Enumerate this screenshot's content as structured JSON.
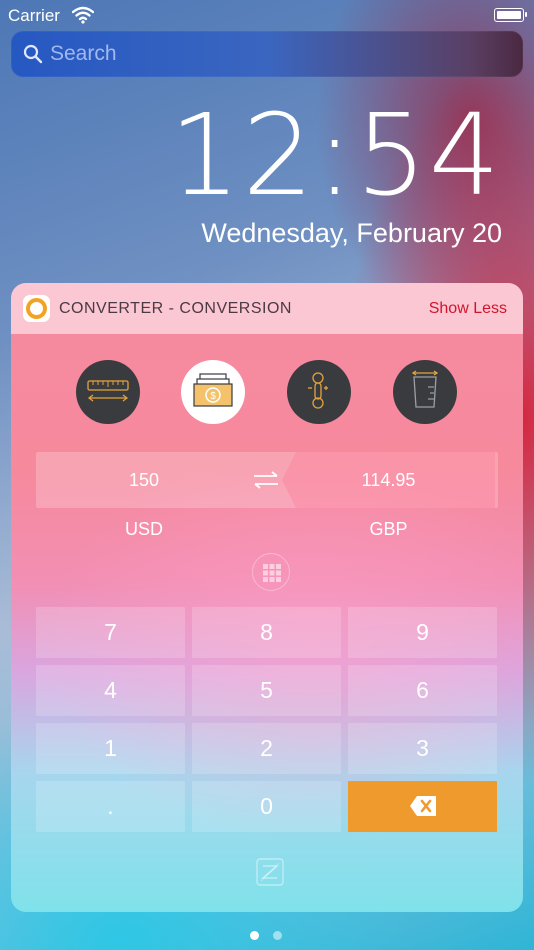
{
  "status_bar": {
    "carrier": "Carrier"
  },
  "search": {
    "placeholder": "Search"
  },
  "lock": {
    "time": "12:54",
    "date": "Wednesday, February 20"
  },
  "widget": {
    "app_name": "CONVERTER - CONVERSION",
    "toggle_label": "Show Less",
    "categories": [
      {
        "name": "length",
        "icon": "ruler-icon",
        "active": false
      },
      {
        "name": "currency",
        "icon": "money-icon",
        "active": true
      },
      {
        "name": "temperature",
        "icon": "thermometer-icon",
        "active": false
      },
      {
        "name": "volume",
        "icon": "beaker-icon",
        "active": false
      }
    ],
    "conversion": {
      "from_value": "150",
      "to_value": "114.95",
      "from_unit": "USD",
      "to_unit": "GBP"
    },
    "keypad": [
      "7",
      "8",
      "9",
      "4",
      "5",
      "6",
      "1",
      "2",
      "3",
      ".",
      "0"
    ]
  },
  "colors": {
    "accent": "#ef9a2d",
    "show_less": "#d2152e",
    "dark_circle": "#3a3b3f"
  },
  "page_dots": {
    "count": 2,
    "active_index": 0
  }
}
